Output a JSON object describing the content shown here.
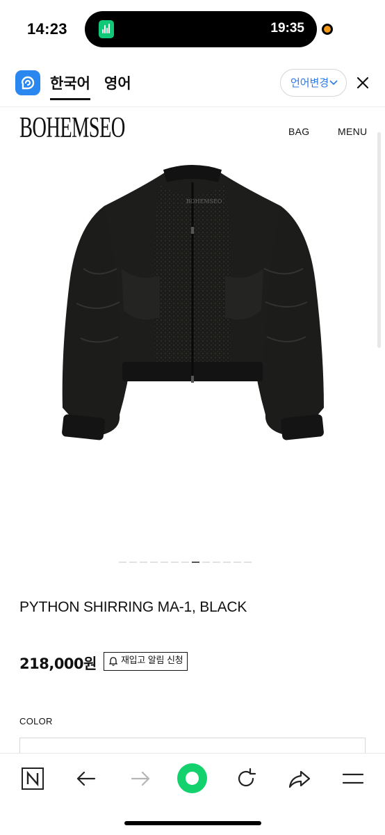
{
  "status_bar": {
    "time": "14:23",
    "island_time": "19:35",
    "island_app_icon": "audio-recorder-icon",
    "island_dot_color": "#f29a17"
  },
  "translate_bar": {
    "app_icon": "papago-icon",
    "source_lang": "한국어",
    "target_lang": "영어",
    "change_language_label": "언어변경",
    "close_icon": "close-icon",
    "accent_color": "#2a7ae2"
  },
  "site_header": {
    "logo": "BOHEMSEO",
    "bag_label": "BAG",
    "menu_label": "MENU"
  },
  "product": {
    "image_alt": "black python shirring bomber jacket",
    "carousel_total": 13,
    "carousel_active_index": 7,
    "name": "PYTHON SHIRRING MA-1, BLACK",
    "price": "218,000원",
    "restock_label": "재입고 알림 신청",
    "color_label": "COLOR"
  },
  "toolbar": {
    "items": [
      "naver-n-icon",
      "back-arrow-icon",
      "forward-arrow-icon",
      "green-home-icon",
      "reload-icon",
      "share-icon",
      "menu-icon"
    ],
    "home_color": "#13d26d"
  }
}
